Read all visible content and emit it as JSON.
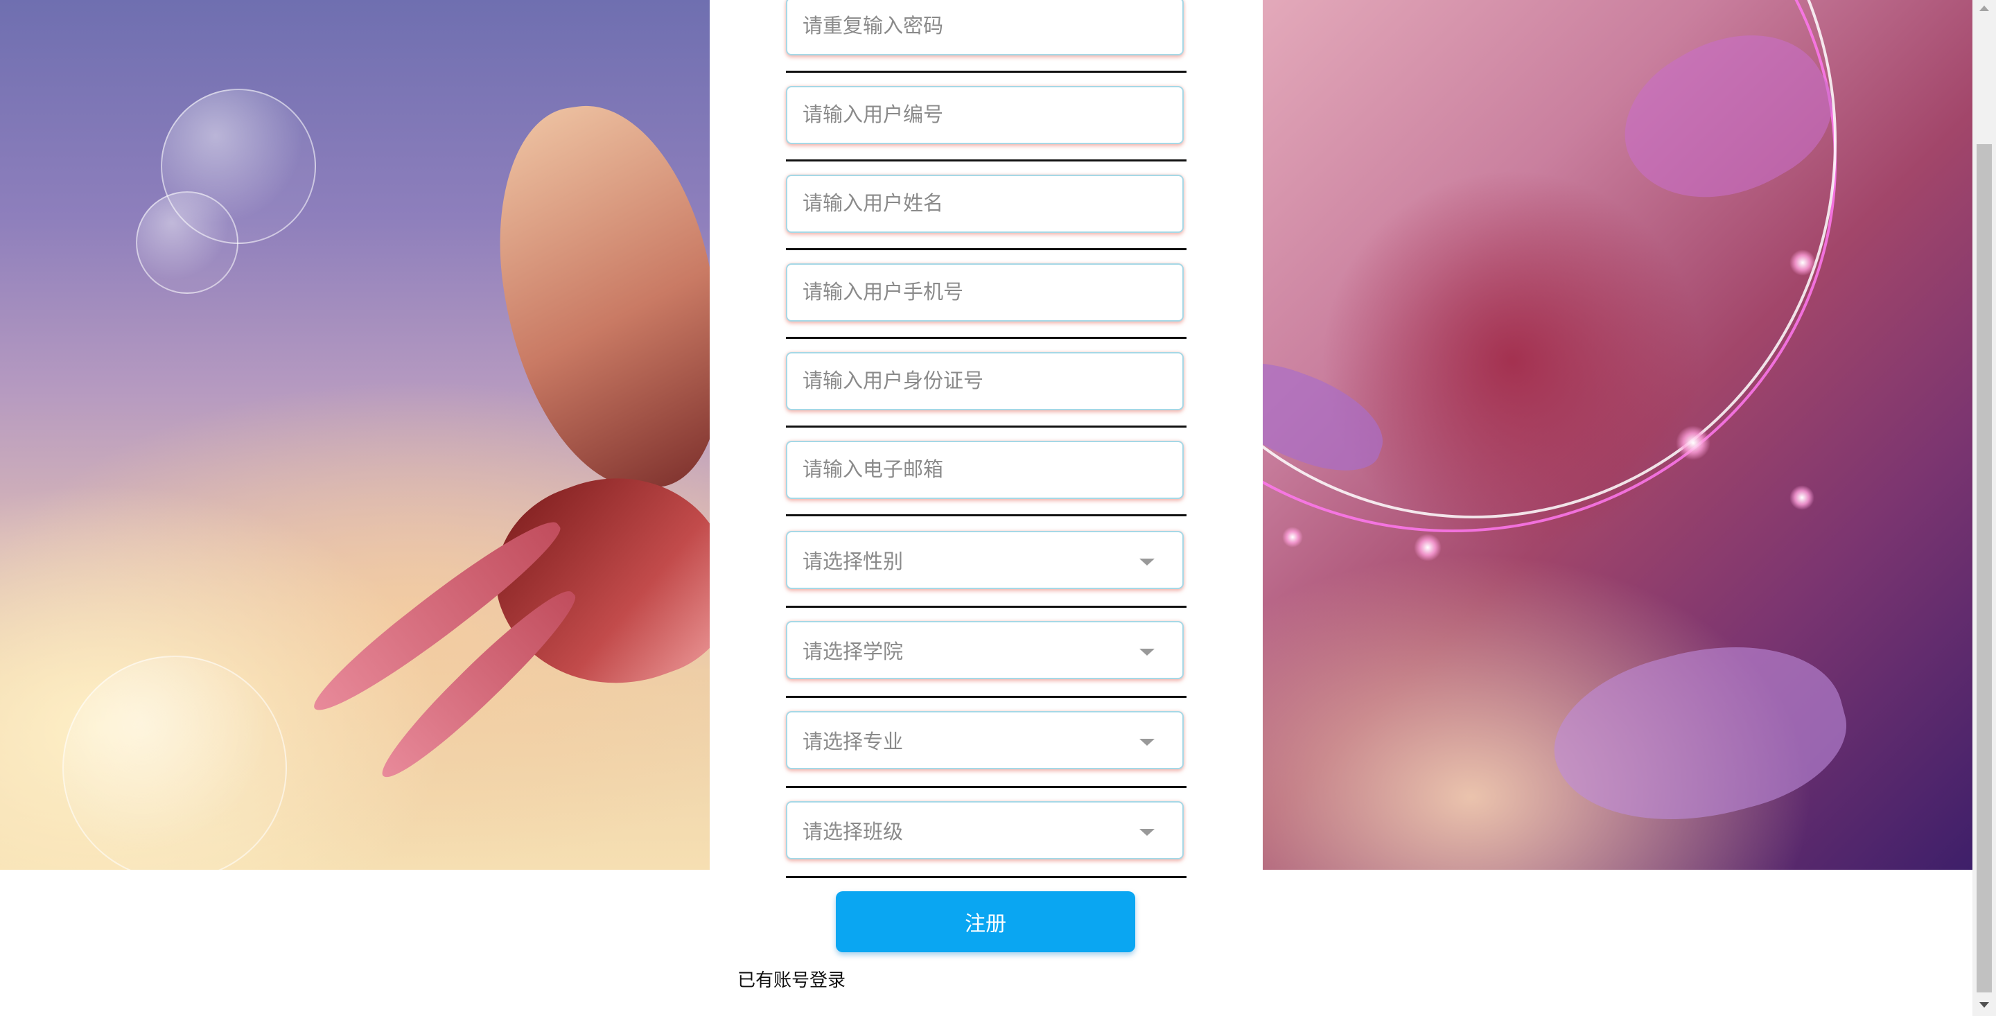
{
  "form": {
    "fields": [
      {
        "type": "input",
        "placeholder": "请重复输入密码"
      },
      {
        "type": "input",
        "placeholder": "请输入用户编号"
      },
      {
        "type": "input",
        "placeholder": "请输入用户姓名"
      },
      {
        "type": "input",
        "placeholder": "请输入用户手机号"
      },
      {
        "type": "input",
        "placeholder": "请输入用户身份证号"
      },
      {
        "type": "input",
        "placeholder": "请输入电子邮箱"
      },
      {
        "type": "select",
        "placeholder": "请选择性别"
      },
      {
        "type": "select",
        "placeholder": "请选择学院"
      },
      {
        "type": "select",
        "placeholder": "请选择专业"
      },
      {
        "type": "select",
        "placeholder": "请选择班级"
      }
    ],
    "register_label": "注册",
    "login_link": "已有账号登录"
  },
  "icons": {
    "select_caret": "chevron-down-icon"
  },
  "colors": {
    "button": "#0aa6f2",
    "field_border": "#a6d8e6",
    "field_shadow": "#eb8c82"
  }
}
